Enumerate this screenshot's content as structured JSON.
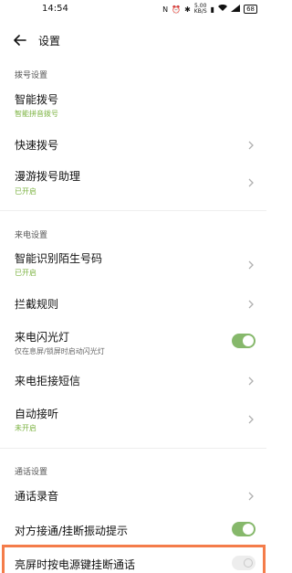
{
  "status_bar": {
    "time": "14:54",
    "speed_top": "5.00",
    "speed_unit": "KB/S",
    "battery": "68"
  },
  "header": {
    "title": "设置"
  },
  "sections": {
    "dial": "拨号设置",
    "incoming": "来电设置",
    "call": "通话设置"
  },
  "items": {
    "smart_dial": {
      "title": "智能拨号",
      "subtitle": "智能拼音拨号"
    },
    "speed_dial": {
      "title": "快速拨号"
    },
    "roaming": {
      "title": "漫游拨号助理",
      "subtitle": "已开启"
    },
    "unknown_id": {
      "title": "智能识别陌生号码",
      "subtitle": "已开启"
    },
    "block": {
      "title": "拦截规则"
    },
    "flash": {
      "title": "来电闪光灯",
      "subtitle": "仅在息屏/锁屏时启动闪光灯",
      "enabled": true
    },
    "reject_sms": {
      "title": "来电拒接短信"
    },
    "auto_answer": {
      "title": "自动接听",
      "subtitle": "未开启"
    },
    "recording": {
      "title": "通话录音"
    },
    "vibrate": {
      "title": "对方接通/挂断振动提示",
      "enabled": true
    },
    "power_hangup": {
      "title": "亮屏时按电源键挂断通话",
      "enabled": false
    }
  },
  "colors": {
    "accent_green": "#7cb342",
    "toggle_on": "#86b86b",
    "highlight": "#f47c4a"
  }
}
